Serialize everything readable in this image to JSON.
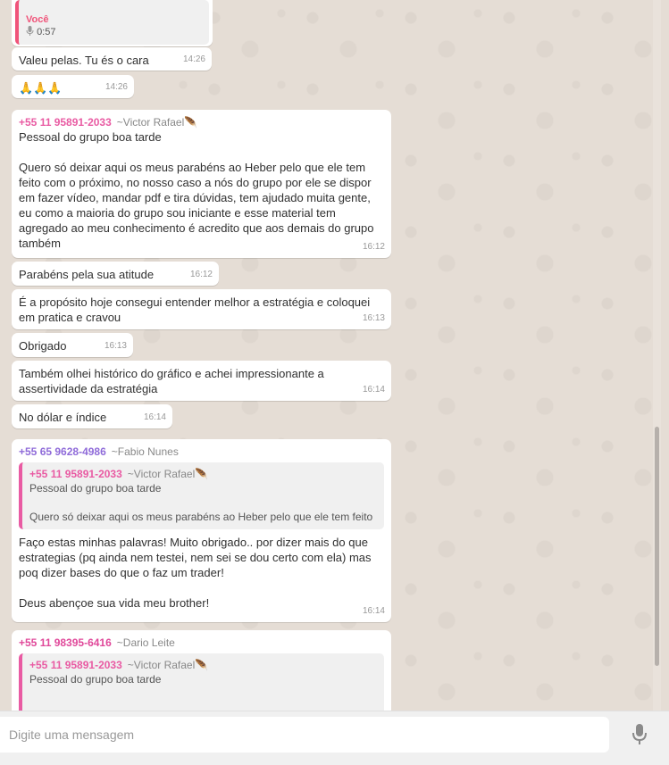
{
  "messages": [
    {
      "type": "voice",
      "quote_sender": "Você",
      "duration": "0:57"
    },
    {
      "type": "text",
      "text": "Valeu pelas. Tu és o cara",
      "time": "14:26"
    },
    {
      "type": "text",
      "text": "🙏🙏🙏",
      "time": "14:26"
    },
    {
      "type": "group",
      "sender": "+55 11 95891-2033",
      "alias": "~Victor Rafael🪶",
      "text": "Pessoal do grupo boa tarde\n\nQuero só deixar aqui os meus parabéns ao Heber pelo que ele tem feito com o próximo, no nosso caso a nós do grupo por ele se dispor em fazer vídeo, mandar pdf e tira dúvidas, tem ajudado muita gente, eu como a maioria do grupo sou iniciante e esse material tem agregado ao meu conhecimento é acredito que aos demais do grupo também",
      "time": "16:12"
    },
    {
      "type": "text",
      "text": "Parabéns pela sua atitude",
      "time": "16:12"
    },
    {
      "type": "text",
      "text": "É a propósito hoje consegui entender melhor a estratégia e coloquei em pratica e cravou",
      "time": "16:13"
    },
    {
      "type": "text",
      "text": "Obrigado",
      "time": "16:13"
    },
    {
      "type": "text",
      "text": "Também olhei histórico do gráfico e achei impressionante a assertividade da estratégia",
      "time": "16:14"
    },
    {
      "type": "text",
      "text": "No dólar e índice",
      "time": "16:14"
    },
    {
      "type": "reply",
      "sender": "+55 65 9628-4986",
      "alias": "~Fabio Nunes",
      "quote_sender": "+55 11 95891-2033",
      "quote_alias": "~Victor Rafael🪶",
      "quote_text": "Pessoal do grupo boa tarde\n\nQuero só deixar aqui os meus parabéns ao Heber pelo que ele tem feito",
      "text": "Faço estas minhas palavras! Muito obrigado.. por dizer mais do que estrategias (pq ainda nem testei, nem sei se dou certo com ela) mas poq dizer bases do que o faz um trader!\n\nDeus abençoe sua vida meu brother!",
      "time": "16:14"
    },
    {
      "type": "reply",
      "sender": "+55 11 98395-6416",
      "alias": "~Dario Leite",
      "quote_sender": "+55 11 95891-2033",
      "quote_alias": "~Victor Rafael🪶",
      "quote_text": "Pessoal do grupo boa tarde"
    }
  ],
  "input": {
    "placeholder": "Digite uma mensagem"
  },
  "icons": {
    "voice": "microphone-icon",
    "send": "microphone-icon"
  },
  "colors": {
    "you": "#f0547a",
    "victor": "#e95ba3",
    "fabio": "#8f6bd9",
    "dario": "#e0489a",
    "bubble": "#ffffff",
    "background": "#e5ddd5"
  }
}
